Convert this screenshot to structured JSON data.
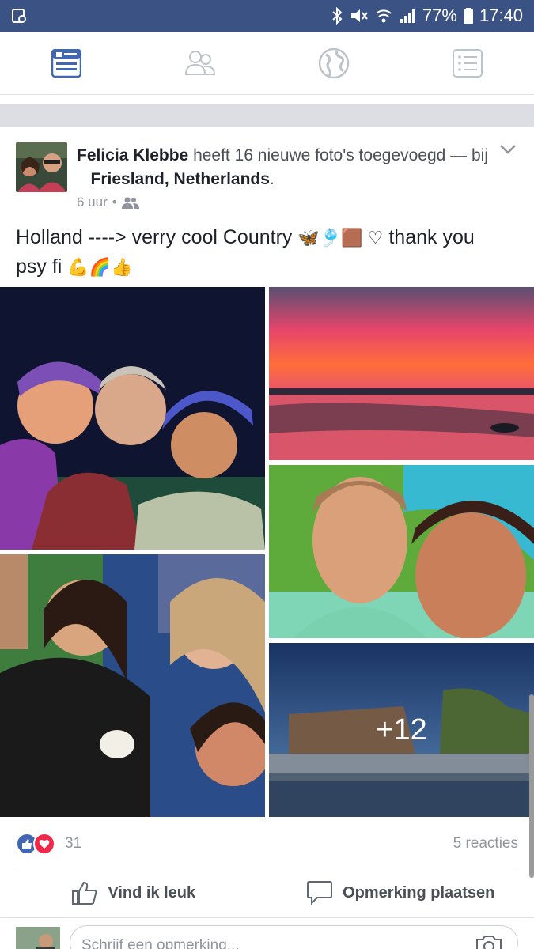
{
  "status": {
    "battery": "77%",
    "time": "17:40"
  },
  "tabs": [
    {
      "name": "news-feed",
      "active": true
    },
    {
      "name": "friends",
      "active": false
    },
    {
      "name": "notifications",
      "active": false
    },
    {
      "name": "menu",
      "active": false
    }
  ],
  "post": {
    "author": "Felicia Klebbe",
    "action": "heeft 16 nieuwe foto's toegevoegd — bij",
    "location": "Friesland, Netherlands",
    "location_suffix": ".",
    "time": "6 uur",
    "separator": "•",
    "message_line1": "Holland ----> verry cool Country",
    "message_line1_emoji": "🦋🎐🟫 ♡",
    "message_line1_end": "thank you",
    "message_line2": "psy fi",
    "message_line2_emoji": "💪🌈👍",
    "more_photos": "+12",
    "reaction_count": "31",
    "comments_label": "5 reacties",
    "like_label": "Vind ik leuk",
    "comment_label": "Opmerking plaatsen",
    "comment_placeholder": "Schrijf een opmerking..."
  },
  "colors": {
    "brand": "#3b5285",
    "like_blue": "#4267b2",
    "love_red": "#f0284a"
  }
}
